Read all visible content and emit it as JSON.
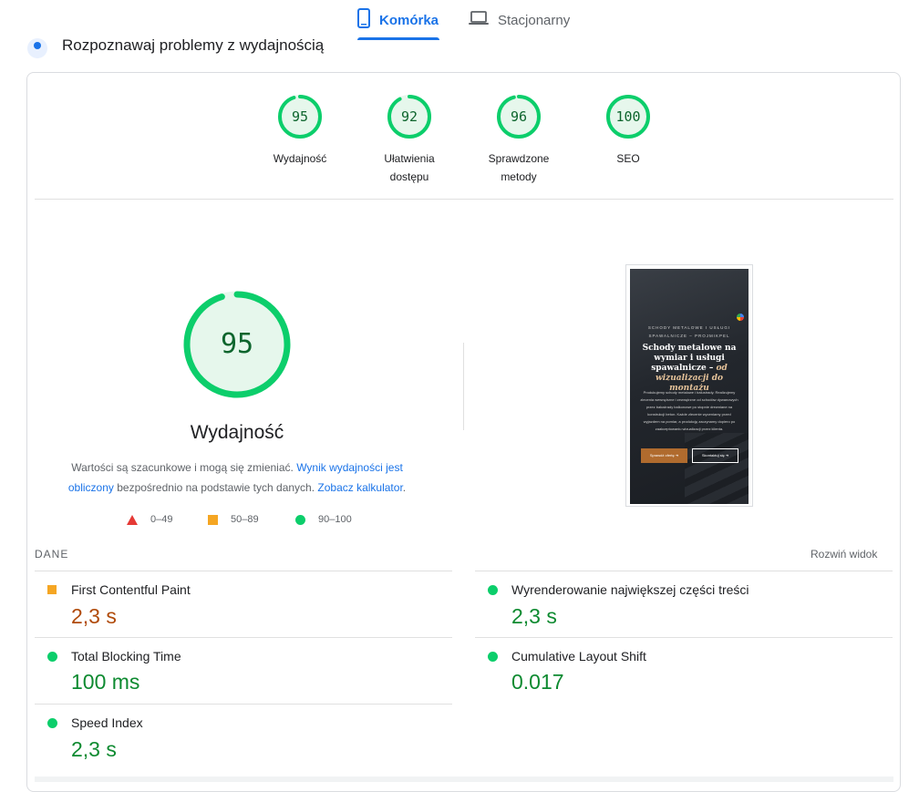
{
  "tabs": {
    "mobile_label": "Komórka",
    "desktop_label": "Stacjonarny"
  },
  "section_title": "Rozpoznawaj problemy z wydajnością",
  "categories": [
    {
      "score": "95",
      "label": "Wydajność",
      "value": 95
    },
    {
      "score": "92",
      "label": "Ułatwienia dostępu",
      "value": 92
    },
    {
      "score": "96",
      "label": "Sprawdzone metody",
      "value": 96
    },
    {
      "score": "100",
      "label": "SEO",
      "value": 100
    }
  ],
  "main_score": {
    "score": "95",
    "value": 95,
    "title": "Wydajność"
  },
  "description": {
    "part1": "Wartości są szacunkowe i mogą się zmieniać. ",
    "link1": "Wynik wydajności jest obliczony",
    "part2": " bezpośrednio na podstawie tych danych. ",
    "link2": "Zobacz kalkulator",
    "part3": "."
  },
  "legend": {
    "fail": "0–49",
    "average": "50–89",
    "pass": "90–100"
  },
  "screenshot": {
    "subtitle": "SCHODY METALOWE I USŁUGI SPAWALNICZE – PROJMIKPEL",
    "heading_plain": "Schody metalowe na wymiar i usługi spawalnicze – ",
    "heading_italic": "od wizualizacji do montażu",
    "body": "Produkujemy schody metalowe i balustrady. Realizujemy zlecenia wewnętrzne i zewnętrzne od schodów dywanowych przez balustrady balkonowe po stopnie drewniane na konstrukcji beton. Każde zlecenie wyceniamy przed wyjazdem na pomiar, a produkcję zaczynamy dopiero po zaakceptowaniu wizualizacji przez klienta.",
    "button1": "Sprawdź ofertę ➜",
    "button2": "Skontaktuj się ➜"
  },
  "data_section": {
    "label": "DANE",
    "expand_label": "Rozwiń widok"
  },
  "metrics": {
    "fcp": {
      "title": "First Contentful Paint",
      "value": "2,3 s",
      "status": "average"
    },
    "lcp": {
      "title": "Wyrenderowanie największej części treści",
      "value": "2,3 s",
      "status": "pass"
    },
    "tbt": {
      "title": "Total Blocking Time",
      "value": "100 ms",
      "status": "pass"
    },
    "cls": {
      "title": "Cumulative Layout Shift",
      "value": "0.017",
      "status": "pass"
    },
    "si": {
      "title": "Speed Index",
      "value": "2,3 s",
      "status": "pass"
    }
  },
  "colors": {
    "accent": "#1a73e8",
    "pass": "#0cce6b",
    "pass_text": "#0d652d",
    "average": "#f5a623",
    "fail": "#e53935"
  },
  "icons": {
    "mobile": "smartphone-icon",
    "desktop": "laptop-icon",
    "section": "lighthouse-icon"
  }
}
